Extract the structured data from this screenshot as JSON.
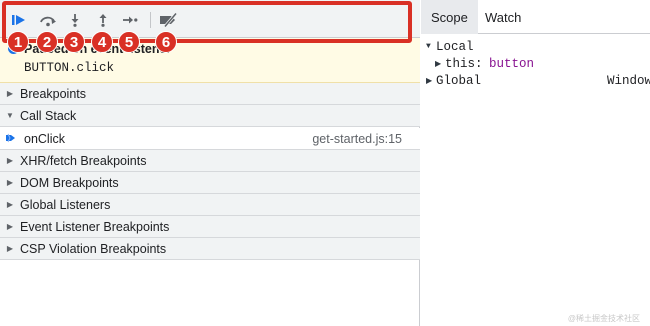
{
  "toolbar": {
    "buttons": [
      {
        "name": "resume-icon",
        "title": "Resume"
      },
      {
        "name": "step-over-icon",
        "title": "Step over"
      },
      {
        "name": "step-into-icon",
        "title": "Step into"
      },
      {
        "name": "step-out-icon",
        "title": "Step out"
      },
      {
        "name": "step-icon",
        "title": "Step"
      },
      {
        "name": "deactivate-breakpoints-icon",
        "title": "Deactivate breakpoints"
      }
    ],
    "accent_color": "#1a73e8"
  },
  "annotation": {
    "color": "#d93025",
    "badges": [
      "1",
      "2",
      "3",
      "4",
      "5",
      "6"
    ]
  },
  "paused": {
    "title": "Paused on event listener",
    "detail": "BUTTON.click"
  },
  "sections": {
    "breakpoints": "Breakpoints",
    "call_stack": "Call Stack",
    "xhr": "XHR/fetch Breakpoints",
    "dom": "DOM Breakpoints",
    "global_listeners": "Global Listeners",
    "event_listener": "Event Listener Breakpoints",
    "csp": "CSP Violation Breakpoints"
  },
  "call_stack": {
    "frames": [
      {
        "function": "onClick",
        "location": "get-started.js:15"
      }
    ]
  },
  "right_panel": {
    "tabs": [
      "Scope",
      "Watch"
    ],
    "active_tab": "Scope",
    "scope": {
      "local_label": "Local",
      "this_name": "this:",
      "this_value": "button",
      "global_label": "Global",
      "global_value": "Window"
    }
  },
  "watermark": "@稀土掘金技术社区"
}
